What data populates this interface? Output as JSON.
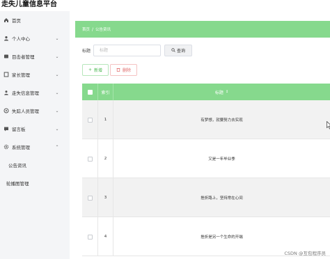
{
  "app": {
    "title": "走失儿童信息平台"
  },
  "sidebar": {
    "items": [
      {
        "label": "首页",
        "icon": "home-icon",
        "has_chevron": false
      },
      {
        "label": "个人中心",
        "icon": "user-icon",
        "has_chevron": true
      },
      {
        "label": "目击者管理",
        "icon": "witness-icon",
        "has_chevron": true
      },
      {
        "label": "家长管理",
        "icon": "parent-icon",
        "has_chevron": true
      },
      {
        "label": "走失信息管理",
        "icon": "lost-info-icon",
        "has_chevron": true
      },
      {
        "label": "失踪人员管理",
        "icon": "missing-person-icon",
        "has_chevron": true
      },
      {
        "label": "留言板",
        "icon": "message-board-icon",
        "has_chevron": true
      },
      {
        "label": "系统管理",
        "icon": "system-gear-icon",
        "has_chevron": true,
        "expanded": true
      }
    ],
    "sub_items": [
      "公告资讯",
      "轮播图管理"
    ]
  },
  "breadcrumb": {
    "home": "首页",
    "separator": "/",
    "current": "公告资讯"
  },
  "search": {
    "label": "标题",
    "placeholder": "标题",
    "value": "",
    "button_label": "查询"
  },
  "actions": {
    "add_label": "新增",
    "delete_label": "删除"
  },
  "table": {
    "columns": {
      "index": "索引",
      "title": "标题"
    },
    "rows": [
      {
        "index": "1",
        "title": "有梦想，就要努力去实现"
      },
      {
        "index": "2",
        "title": "又是一年毕业季"
      },
      {
        "index": "3",
        "title": "挫折路上，坚持常在心间"
      },
      {
        "index": "4",
        "title": "挫折是另一个生命的开端"
      }
    ]
  },
  "watermark": "CSDN @互包程序员",
  "colors": {
    "accent_green": "#86d98d",
    "danger_red": "#e06c6c",
    "sidebar_bg": "#f4f5f7"
  }
}
